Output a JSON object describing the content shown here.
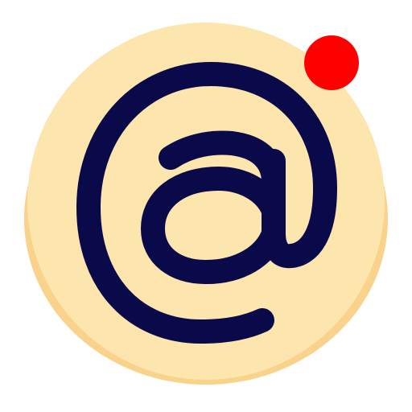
{
  "icon": {
    "name": "at-sign-icon",
    "badge": "notification-dot",
    "colors": {
      "disc_face": "#FDE6AE",
      "disc_edge": "#F9D28B",
      "glyph": "#0A0A4A",
      "badge": "#FF0000"
    }
  }
}
